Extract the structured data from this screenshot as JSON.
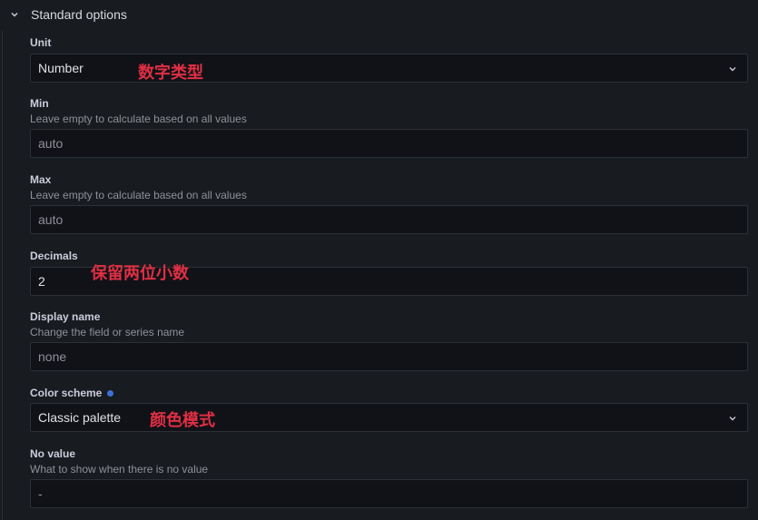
{
  "section": {
    "title": "Standard options",
    "expand_icon": "chevron-down-icon"
  },
  "fields": {
    "unit": {
      "label": "Unit",
      "value": "Number"
    },
    "min": {
      "label": "Min",
      "description": "Leave empty to calculate based on all values",
      "placeholder": "auto"
    },
    "max": {
      "label": "Max",
      "description": "Leave empty to calculate based on all values",
      "placeholder": "auto"
    },
    "decimals": {
      "label": "Decimals",
      "value": "2"
    },
    "display_name": {
      "label": "Display name",
      "description": "Change the field or series name",
      "placeholder": "none"
    },
    "color_scheme": {
      "label": "Color scheme",
      "value": "Classic palette",
      "modified_indicator_color": "#3d71d9"
    },
    "no_value": {
      "label": "No value",
      "description": "What to show when there is no value",
      "placeholder": "-"
    }
  },
  "annotations": {
    "unit_note": "数字类型",
    "decimals_note": "保留两位小数",
    "color_note": "颜色模式"
  },
  "colors": {
    "background": "#181b1f",
    "input_background": "#111217",
    "annotation": "#e02f44"
  }
}
